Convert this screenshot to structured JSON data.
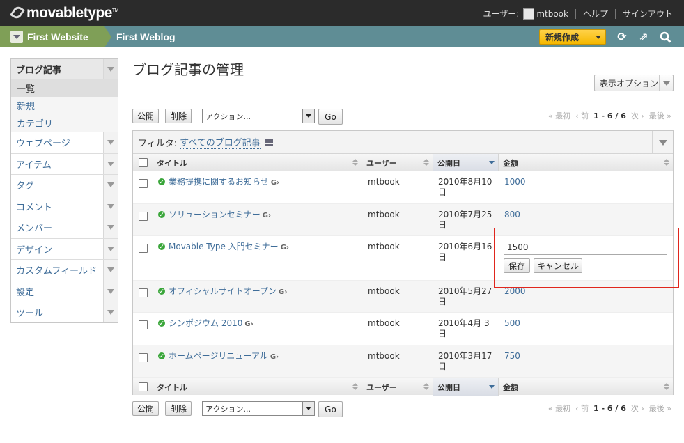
{
  "header": {
    "logo_text": "movabletype",
    "logo_tm": "TM",
    "user_label": "ユーザー:",
    "username": "mtbook",
    "help_label": "ヘルプ",
    "signout_label": "サインアウト"
  },
  "context": {
    "website": "First Website",
    "blog": "First Weblog",
    "new_button": "新規作成"
  },
  "sidebar": {
    "active_menu": "ブログ記事",
    "submenu": [
      "一覧",
      "新規",
      "カテゴリ"
    ],
    "items": [
      "ウェブページ",
      "アイテム",
      "タグ",
      "コメント",
      "メンバー",
      "デザイン",
      "カスタムフィールド",
      "設定",
      "ツール"
    ]
  },
  "main": {
    "title": "ブログ記事の管理",
    "display_options": "表示オプション",
    "publish_label": "公開",
    "delete_label": "削除",
    "action_select": "アクション...",
    "go_label": "Go",
    "pager": {
      "first": "« 最初",
      "prev": "‹ 前",
      "range": "1 - 6 / 6",
      "next": "次 ›",
      "last": "最後 »"
    },
    "filter_label": "フィルタ:",
    "filter_value": "すべてのブログ記事",
    "columns": {
      "title": "タイトル",
      "user": "ユーザー",
      "date": "公開日",
      "amount": "金額"
    },
    "rows": [
      {
        "title": "業務提携に関するお知らせ",
        "user": "mtbook",
        "date1": "2010年8月10",
        "date2": "日",
        "amount": "1000"
      },
      {
        "title": "ソリューションセミナー",
        "user": "mtbook",
        "date1": "2010年7月25",
        "date2": "日",
        "amount": "800"
      },
      {
        "title": "Movable Type 入門セミナー",
        "user": "mtbook",
        "date1": "2010年6月16",
        "date2": "日",
        "amount": ""
      },
      {
        "title": "オフィシャルサイトオープン",
        "user": "mtbook",
        "date1": "2010年5月27",
        "date2": "日",
        "amount": "2000"
      },
      {
        "title": "シンポジウム 2010",
        "user": "mtbook",
        "date1": "2010年4月 3",
        "date2": "日",
        "amount": "500"
      },
      {
        "title": "ホームページリニューアル",
        "user": "mtbook",
        "date1": "2010年3月17",
        "date2": "日",
        "amount": "750"
      }
    ],
    "inline_edit": {
      "value": "1500",
      "save_label": "保存",
      "cancel_label": "キャンセル"
    }
  },
  "colors": {
    "header_bg": "#2b2b2b",
    "context_bg": "#5f8d95",
    "website_bg": "#7f9f57",
    "new_button_bg": "#f5b800",
    "link": "#3f6d99",
    "highlight": "#e0261d"
  }
}
